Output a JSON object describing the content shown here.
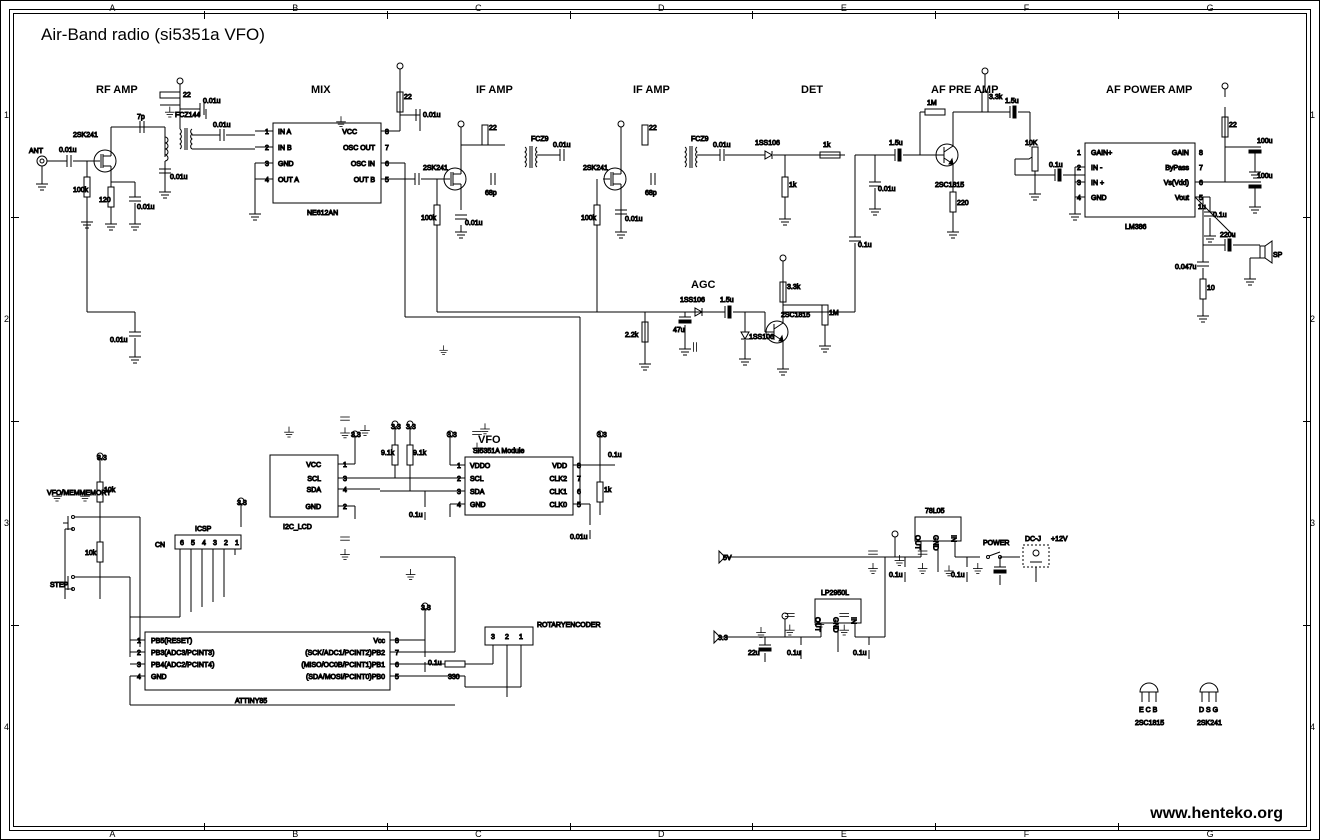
{
  "title": "Air-Band radio (si5351a VFO)",
  "url": "www.henteko.org",
  "grid": {
    "cols": [
      "A",
      "B",
      "C",
      "D",
      "E",
      "F",
      "G"
    ],
    "rows": [
      "1",
      "2",
      "3",
      "4"
    ]
  },
  "blocks": {
    "rf_amp": "RF AMP",
    "mix": "MIX",
    "if_amp1": "IF AMP",
    "if_amp2": "IF AMP",
    "det": "DET",
    "af_pre": "AF PRE AMP",
    "af_pwr": "AF POWER AMP",
    "agc": "AGC",
    "vfo": "VFO"
  },
  "parts": {
    "ant": "ANT",
    "fet241": "2SK241",
    "c7p": "7p",
    "c001u": "0.01u",
    "r100k": "100k",
    "r120": "120",
    "r22": "22",
    "fcz144": "FCZ144",
    "ne612": "NE612AN",
    "ne612_pins": {
      "ina": "IN A",
      "inb": "IN B",
      "gnd": "GND",
      "outa": "OUT A",
      "vcc": "VCC",
      "oscout": "OSC OUT",
      "oscin": "OSC IN",
      "outb": "OUT B"
    },
    "c68p": "68p",
    "fcz9": "FCZ9",
    "d1ss106": "1SS106",
    "r1k": "1k",
    "c15u": "1.5u",
    "bjt1815": "2SC1815",
    "r1m": "1M",
    "r33k": "3.3k",
    "r220": "220",
    "r22k": "2.2k",
    "c47u": "47u",
    "c01u": "0.1u",
    "c100u": "100u",
    "c220u": "220u",
    "c0047u": "0.047u",
    "r10": "10",
    "r10k": "10K",
    "r10k_l": "10k",
    "sp": "SP",
    "lm386": "LM386",
    "lm386_pins": {
      "gainp": "GAIN+",
      "inm": "IN -",
      "inp": "IN +",
      "gnd": "GND",
      "gain": "GAIN",
      "byp": "ByPass",
      "vdd": "Vs(Vdd)",
      "vout": "Vout"
    },
    "icsp": "ICSP",
    "cn": "CN",
    "i2c_lcd": "I2C_LCD",
    "i2c_pins": {
      "vcc": "VCC",
      "scl": "SCL",
      "sda": "SDA",
      "gnd": "GND"
    },
    "si5351": "SI5351A Module",
    "si5351_pins": {
      "vddo": "VDDO",
      "scl": "SCL",
      "sda": "SDA",
      "gnd": "GND",
      "vdd": "VDD",
      "clk2": "CLK2",
      "clk1": "CLK1",
      "clk0": "CLK0"
    },
    "attiny": "ATTINY85",
    "attiny_pins": {
      "pb5": "PB5(RESET)",
      "pb3": "PB3(ADC3/PCINT3)",
      "pb4": "PB4(ADC2/PCINT4)",
      "gnd": "GND",
      "vcc": "Vcc",
      "pb2": "(SCK/ADC1/PCINT2)PB2",
      "pb1": "(MISO/OC0B/PCINT1)PB1",
      "pb0": "(SDA/MOSI/PCINT0)PB0"
    },
    "rot_enc": "ROTARY\nENCODER",
    "r330": "330",
    "r91k": "9.1k",
    "v33": "3.3",
    "v5": "5V",
    "v12": "+12V",
    "dcj": "DC-J",
    "power_sw": "POWER",
    "reg78l05": "78L05",
    "reglp2950": "LP2950L",
    "reg_pins": {
      "out": "OUT",
      "gnd": "GND",
      "in": "IN"
    },
    "c22u": "22u",
    "c1uval": "1u",
    "vfo_mem": "VFO/MEM\nMEMORY",
    "step": "STEP",
    "ecb": "E C B",
    "dsg": "D S G",
    "pinout_bjt": "2SC1815",
    "pinout_fet": "2SK241",
    "pin_labels_8": [
      "1",
      "2",
      "3",
      "4",
      "5",
      "6",
      "7",
      "8"
    ],
    "pin_labels_6cn": [
      "6",
      "5",
      "4",
      "3",
      "2",
      "1"
    ],
    "pin_labels_3": [
      "3",
      "2",
      "1"
    ]
  }
}
